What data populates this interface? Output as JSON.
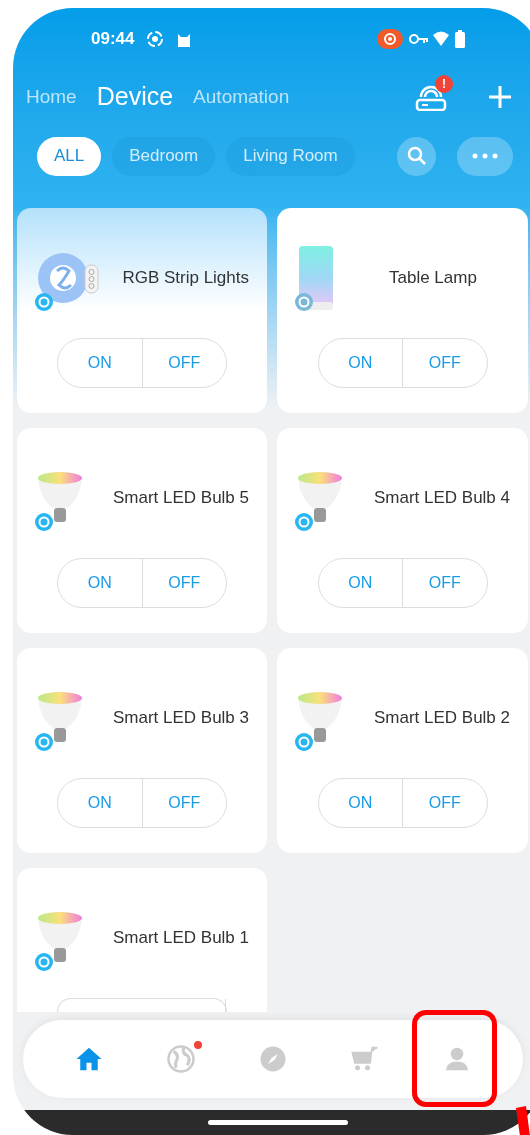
{
  "status_bar": {
    "time": "09:44"
  },
  "tabs": [
    {
      "label": "Home",
      "selected": false
    },
    {
      "label": "Device",
      "selected": true
    },
    {
      "label": "Automation",
      "selected": false
    }
  ],
  "hub": {
    "alert": "!"
  },
  "filters": [
    {
      "label": "ALL",
      "selected": true
    },
    {
      "label": "Bedroom",
      "selected": false
    },
    {
      "label": "Living Room",
      "selected": false
    }
  ],
  "devices": [
    {
      "name": "RGB Strip Lights",
      "kind": "strip",
      "highlighted": true,
      "buttons": [
        "ON",
        "OFF"
      ]
    },
    {
      "name": "Table Lamp",
      "kind": "lamp",
      "highlighted": false,
      "buttons": [
        "ON",
        "OFF"
      ]
    },
    {
      "name": "Smart LED Bulb 5",
      "kind": "bulb",
      "highlighted": false,
      "buttons": [
        "ON",
        "OFF"
      ]
    },
    {
      "name": "Smart LED Bulb 4",
      "kind": "bulb",
      "highlighted": false,
      "buttons": [
        "ON",
        "OFF"
      ]
    },
    {
      "name": "Smart LED Bulb 3",
      "kind": "bulb",
      "highlighted": false,
      "buttons": [
        "ON",
        "OFF"
      ]
    },
    {
      "name": "Smart LED Bulb 2",
      "kind": "bulb",
      "highlighted": false,
      "buttons": [
        "ON",
        "OFF"
      ]
    },
    {
      "name": "Smart LED Bulb 1",
      "kind": "bulb",
      "highlighted": false
    }
  ],
  "bottom_nav": [
    {
      "kind": "home",
      "selected": true,
      "badge": false
    },
    {
      "kind": "globe",
      "selected": false,
      "badge": true
    },
    {
      "kind": "compass",
      "selected": false,
      "badge": false
    },
    {
      "kind": "cart",
      "selected": false,
      "badge": false
    },
    {
      "kind": "profile",
      "selected": false,
      "badge": false,
      "highlighted": true
    }
  ]
}
